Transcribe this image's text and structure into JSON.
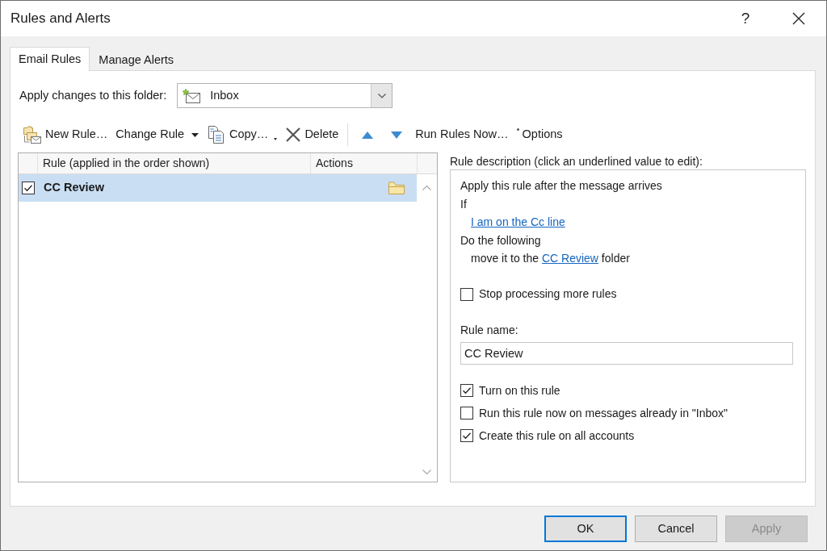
{
  "window": {
    "title": "Rules and Alerts",
    "help": "?"
  },
  "tabs": [
    {
      "label": "Email Rules",
      "selected": true
    },
    {
      "label": "Manage Alerts",
      "selected": false
    }
  ],
  "folder": {
    "label": "Apply changes to this folder:",
    "value": "Inbox"
  },
  "toolbar": [
    {
      "kind": "new",
      "label": "New Rule…",
      "dropdown": false
    },
    {
      "kind": "change",
      "label": "Change Rule",
      "dropdown": true
    },
    {
      "kind": "copy",
      "label": "Copy…",
      "dropdown": true
    },
    {
      "kind": "delete",
      "label": "Delete",
      "dropdown": false
    },
    {
      "kind": "up",
      "dropdown": false
    },
    {
      "kind": "down",
      "dropdown": false
    },
    {
      "kind": "run",
      "label": "Run Rules Now…",
      "dropdown": false
    },
    {
      "kind": "options",
      "label": "Options",
      "dropdown": false
    }
  ],
  "rules": {
    "columns": [
      "Rule (applied in the order shown)",
      "Actions"
    ],
    "rows": [
      {
        "name": "CC Review",
        "checked": true,
        "selected": true
      }
    ]
  },
  "description": {
    "heading": "Rule description (click an underlined value to edit):",
    "lines": [
      {
        "kind": "text",
        "text": "Apply this rule after the message arrives"
      },
      {
        "kind": "text",
        "text": "If",
        "children": [
          {
            "kind": "link",
            "text": "I am on the Cc line"
          }
        ]
      },
      {
        "kind": "text",
        "text": "Do the following",
        "children": [
          {
            "kind": "sentence",
            "text_before": "move it to the",
            "link": "CC Review",
            "text_after": "folder"
          }
        ]
      }
    ],
    "options": [
      {
        "label": "Stop processing more rules",
        "checked": false
      }
    ],
    "rule_name": {
      "label": "Rule name:",
      "value": "CC Review"
    },
    "settings": [
      {
        "label": "Turn on this rule",
        "checked": true
      },
      {
        "label": "Run this rule now on messages already in \"Inbox\"",
        "checked": false
      },
      {
        "label": "Create this rule on all accounts",
        "checked": true
      }
    ]
  },
  "buttons": [
    {
      "label": "OK",
      "default": true,
      "disabled": false
    },
    {
      "label": "Cancel",
      "default": false,
      "disabled": false
    },
    {
      "label": "Apply",
      "default": false,
      "disabled": true
    }
  ]
}
